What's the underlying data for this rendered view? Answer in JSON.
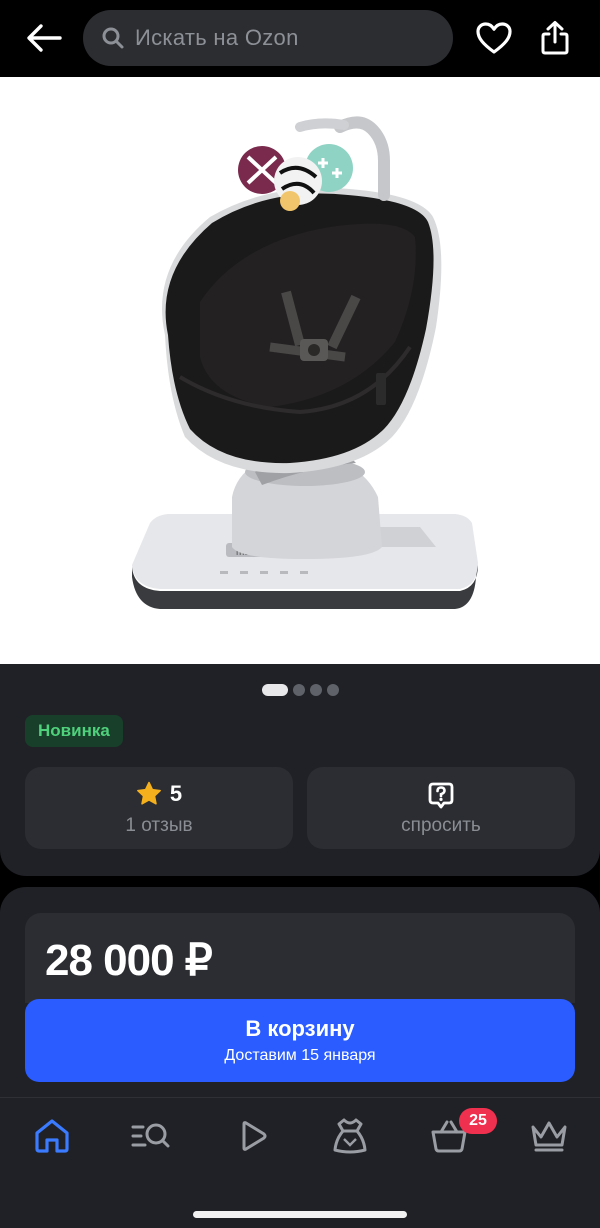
{
  "header": {
    "search_placeholder": "Искать на Ozon",
    "icons": [
      "back-arrow-icon",
      "search-icon",
      "heart-icon",
      "share-icon"
    ]
  },
  "gallery": {
    "image_description": "baby swing seat",
    "pages": 4,
    "active_page": 1
  },
  "product": {
    "badge": "Новинка",
    "rating": {
      "value": "5",
      "reviews": "1 отзыв"
    },
    "ask": {
      "label": "спросить"
    },
    "price": "28 000 ₽"
  },
  "cart_button": {
    "title": "В корзину",
    "subtitle": "Доставим 15 января"
  },
  "bottom_nav": {
    "items": [
      {
        "name": "home",
        "icon": "home-icon",
        "active": true
      },
      {
        "name": "catalog",
        "icon": "catalog-search-icon",
        "active": false
      },
      {
        "name": "video",
        "icon": "play-icon",
        "active": false
      },
      {
        "name": "fresh",
        "icon": "dress-icon",
        "active": false
      },
      {
        "name": "cart",
        "icon": "basket-icon",
        "active": false
      },
      {
        "name": "premium",
        "icon": "crown-icon",
        "active": false
      }
    ],
    "cart_count": "25"
  },
  "colors": {
    "accent": "#2a5cff",
    "badge_bg": "#183f29",
    "badge_text": "#4fd17c",
    "cart_badge": "#f0304f",
    "star": "#f5b01d",
    "nav_active": "#3b7bff"
  }
}
